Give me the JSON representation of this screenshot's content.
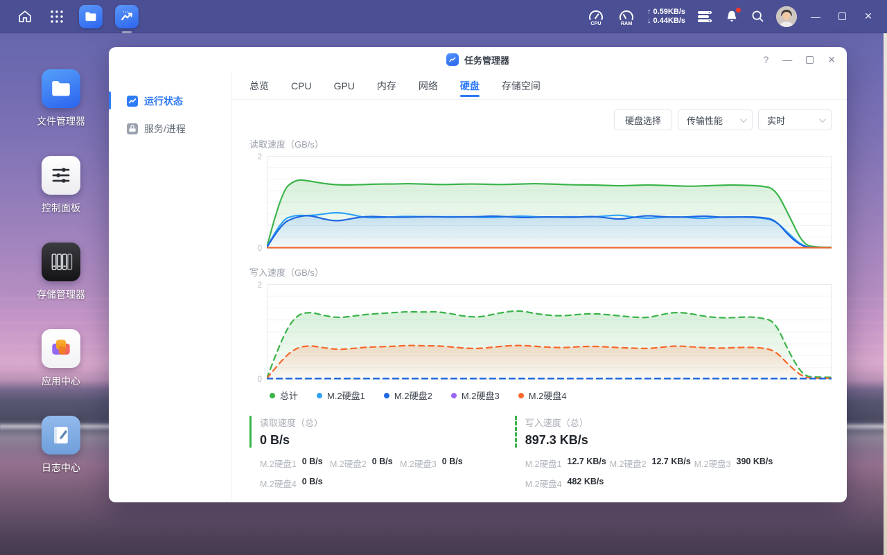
{
  "taskbar": {
    "cpu_label": "CPU",
    "ram_label": "RAM",
    "network_up": "↑ 0.59KB/s",
    "network_down": "↓ 0.44KB/s"
  },
  "desktop": {
    "icons": [
      {
        "label": "文件管理器"
      },
      {
        "label": "控制面板"
      },
      {
        "label": "存储管理器"
      },
      {
        "label": "应用中心"
      },
      {
        "label": "日志中心"
      }
    ]
  },
  "window": {
    "title": "任务管理器",
    "help_label": "?",
    "sidebar": [
      {
        "label": "运行状态",
        "active": true
      },
      {
        "label": "服务/进程",
        "active": false
      }
    ],
    "tabs": [
      {
        "label": "总览",
        "active": false
      },
      {
        "label": "CPU",
        "active": false
      },
      {
        "label": "GPU",
        "active": false
      },
      {
        "label": "内存",
        "active": false
      },
      {
        "label": "网络",
        "active": false
      },
      {
        "label": "硬盘",
        "active": true
      },
      {
        "label": "存储空间",
        "active": false
      }
    ],
    "controls": {
      "disk_select_button": "硬盘选择",
      "perf_dropdown": "传输性能",
      "time_dropdown": "实时"
    }
  },
  "legend": [
    {
      "label": "总计",
      "color": "#3bb44a"
    },
    {
      "label": "M.2硬盘1",
      "color": "#2da3f8"
    },
    {
      "label": "M.2硬盘2",
      "color": "#1f67e0"
    },
    {
      "label": "M.2硬盘3",
      "color": "#9a66f5"
    },
    {
      "label": "M.2硬盘4",
      "color": "#f8692b"
    }
  ],
  "chart_data": [
    {
      "type": "line",
      "title": "读取速度（GB/s）",
      "ylabel": "GB/s",
      "ylim": [
        0,
        2
      ],
      "y_ticks": [
        "2",
        "0"
      ],
      "grid": true,
      "dashed": false,
      "legend_position": "below-second-chart",
      "series": [
        {
          "name": "总计",
          "color": "#3bb44a",
          "fill": "#3bb44a",
          "values": [
            0,
            1.22,
            1.5,
            1.47,
            1.41,
            1.38,
            1.38,
            1.39,
            1.4,
            1.4,
            1.41,
            1.4,
            1.39,
            1.39,
            1.4,
            1.4,
            1.39,
            1.39,
            1.4,
            1.41,
            1.4,
            1.39,
            1.38,
            1.38,
            1.37,
            1.36,
            1.37,
            1.38,
            1.37,
            1.36,
            1.35,
            1.36,
            1.37,
            1.38,
            1.37,
            1.36,
            1.3,
            0.7,
            0.06,
            0.01,
            0.01
          ]
        },
        {
          "name": "M.2硬盘1",
          "color": "#2da3f8",
          "values": [
            0,
            0.6,
            0.72,
            0.7,
            0.74,
            0.78,
            0.73,
            0.66,
            0.66,
            0.68,
            0.69,
            0.68,
            0.68,
            0.68,
            0.68,
            0.67,
            0.66,
            0.68,
            0.7,
            0.68,
            0.67,
            0.68,
            0.68,
            0.67,
            0.7,
            0.72,
            0.67,
            0.64,
            0.67,
            0.68,
            0.66,
            0.64,
            0.67,
            0.68,
            0.67,
            0.66,
            0.6,
            0.3,
            0.02,
            0,
            0
          ]
        },
        {
          "name": "M.2硬盘2",
          "color": "#1f67e0",
          "fill": "#2d82f5",
          "values": [
            0,
            0.52,
            0.67,
            0.72,
            0.63,
            0.58,
            0.64,
            0.69,
            0.68,
            0.67,
            0.67,
            0.68,
            0.68,
            0.67,
            0.68,
            0.68,
            0.7,
            0.68,
            0.66,
            0.67,
            0.68,
            0.67,
            0.67,
            0.69,
            0.66,
            0.62,
            0.67,
            0.71,
            0.68,
            0.67,
            0.68,
            0.7,
            0.67,
            0.67,
            0.68,
            0.67,
            0.62,
            0.25,
            0.01,
            0,
            0
          ]
        },
        {
          "name": "M.2硬盘3",
          "color": "#9a66f5",
          "values": 0
        },
        {
          "name": "M.2硬盘4",
          "color": "#f8692b",
          "values": 0
        }
      ]
    },
    {
      "type": "line",
      "title": "写入速度（GB/s）",
      "ylabel": "GB/s",
      "ylim": [
        0,
        2
      ],
      "y_ticks": [
        "2",
        "0"
      ],
      "grid": true,
      "dashed": true,
      "legend_position": "below",
      "series": [
        {
          "name": "总计",
          "color": "#3bb44a",
          "fill": "#3bb44a",
          "values": [
            0,
            0.82,
            1.34,
            1.43,
            1.35,
            1.3,
            1.33,
            1.37,
            1.39,
            1.41,
            1.43,
            1.42,
            1.43,
            1.39,
            1.33,
            1.31,
            1.37,
            1.43,
            1.45,
            1.39,
            1.35,
            1.34,
            1.37,
            1.39,
            1.37,
            1.34,
            1.31,
            1.3,
            1.37,
            1.42,
            1.39,
            1.33,
            1.3,
            1.3,
            1.32,
            1.3,
            1.22,
            0.55,
            0.05,
            0.03,
            0.03
          ]
        },
        {
          "name": "M.2硬盘3",
          "color": "#9a66f5",
          "values": 0
        },
        {
          "name": "M.2硬盘4",
          "color": "#f8692b",
          "fill": "#f8692b",
          "values": [
            0,
            0.38,
            0.65,
            0.71,
            0.66,
            0.62,
            0.64,
            0.67,
            0.68,
            0.69,
            0.71,
            0.7,
            0.7,
            0.68,
            0.65,
            0.64,
            0.67,
            0.7,
            0.71,
            0.69,
            0.67,
            0.66,
            0.68,
            0.69,
            0.68,
            0.66,
            0.65,
            0.64,
            0.67,
            0.7,
            0.68,
            0.66,
            0.65,
            0.66,
            0.67,
            0.66,
            0.6,
            0.28,
            0.02,
            0.01,
            0.01
          ]
        },
        {
          "name": "M.2硬盘1",
          "color": "#2da3f8",
          "values": 0
        },
        {
          "name": "M.2硬盘2",
          "color": "#1f67e0",
          "values": 0
        }
      ]
    }
  ],
  "stats": {
    "read": {
      "title": "读取速度（总）",
      "value": "0 B/s",
      "items": [
        {
          "label": "M.2硬盘1",
          "value": "0 B/s"
        },
        {
          "label": "M.2硬盘2",
          "value": "0 B/s"
        },
        {
          "label": "M.2硬盘3",
          "value": "0 B/s"
        },
        {
          "label": "M.2硬盘4",
          "value": "0 B/s"
        }
      ]
    },
    "write": {
      "title": "写入速度（总）",
      "value": "897.3 KB/s",
      "items": [
        {
          "label": "M.2硬盘1",
          "value": "12.7 KB/s"
        },
        {
          "label": "M.2硬盘2",
          "value": "12.7 KB/s"
        },
        {
          "label": "M.2硬盘3",
          "value": "390 KB/s"
        },
        {
          "label": "M.2硬盘4",
          "value": "482 KB/s"
        }
      ]
    }
  }
}
